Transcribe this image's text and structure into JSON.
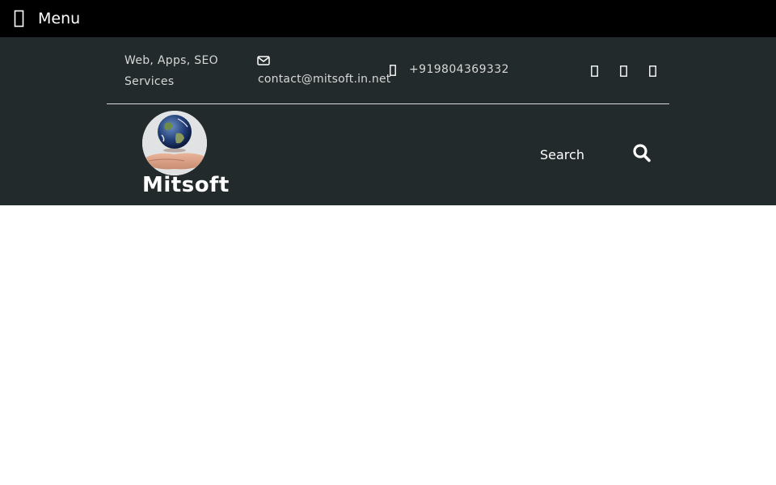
{
  "topbar": {
    "menu_label": "Menu",
    "menu_icon": "bars-icon"
  },
  "header": {
    "tagline": "Web, Apps, SEO Services",
    "email": "contact@mitsoft.in.net",
    "email_icon": "envelope-icon",
    "phone": "+919804369332",
    "phone_icon": "mobile-phone-icon",
    "social_icons": [
      "facebook-icon",
      "twitter-icon",
      "linkedin-icon"
    ]
  },
  "brand": {
    "site_title": "Mitsoft",
    "logo_icon": "globe-in-hand-logo"
  },
  "search": {
    "placeholder": "Search",
    "icon": "search-icon"
  },
  "colors": {
    "topbar_bg": "#000000",
    "header_bg": "#232a2b",
    "header_text": "#d7d7d7",
    "title_text": "#ffffff"
  }
}
